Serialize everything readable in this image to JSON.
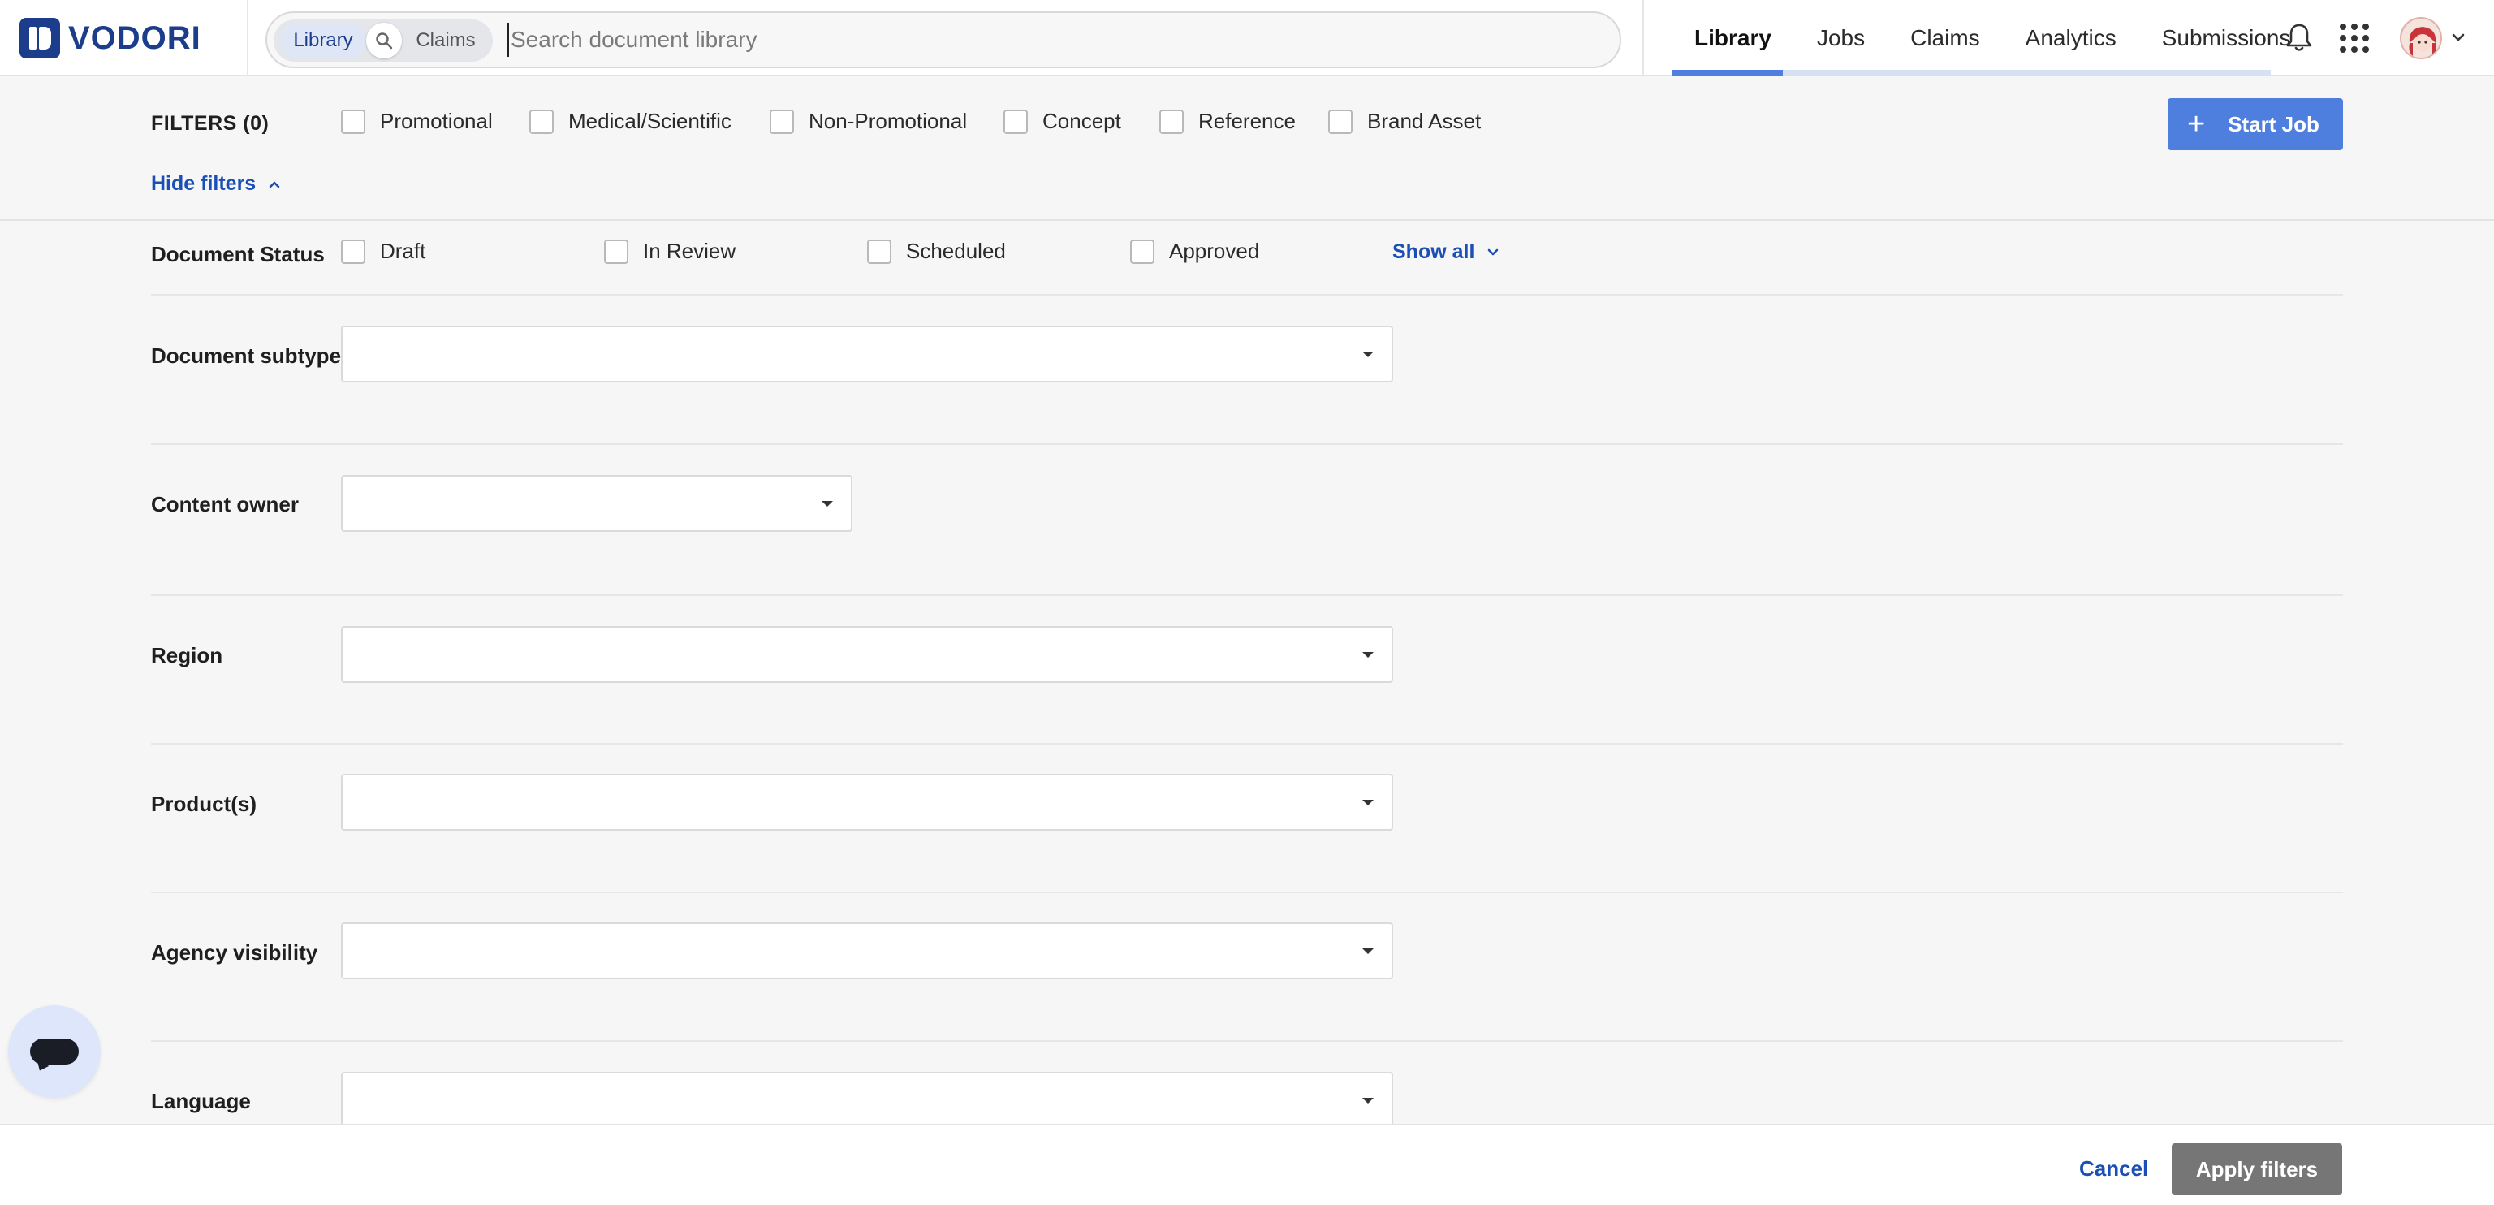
{
  "brand": {
    "name": "VODORI",
    "color": "#1c3c8c"
  },
  "search": {
    "scope_library": "Library",
    "scope_claims": "Claims",
    "placeholder": "Search document library"
  },
  "nav": {
    "items": [
      "Library",
      "Jobs",
      "Claims",
      "Analytics",
      "Submissions"
    ],
    "active": "Library",
    "accent": "#4f7fde"
  },
  "header_icons": {
    "notifications": "bell-icon",
    "apps": "grid-icon",
    "profile": "avatar",
    "profile_menu": "chevron-down-icon"
  },
  "filters": {
    "title": "FILTERS (0)",
    "content_types": [
      "Promotional",
      "Medical/Scientific",
      "Non-Promotional",
      "Concept",
      "Reference",
      "Brand Asset"
    ],
    "hide_label": "Hide filters",
    "start_job_label": "Start Job",
    "document_status": {
      "label": "Document Status",
      "options": [
        "Draft",
        "In Review",
        "Scheduled",
        "Approved"
      ],
      "show_all_label": "Show all"
    },
    "fields": [
      {
        "label": "Document subtype",
        "value": ""
      },
      {
        "label": "Content owner",
        "value": ""
      },
      {
        "label": "Region",
        "value": ""
      },
      {
        "label": "Product(s)",
        "value": ""
      },
      {
        "label": "Agency visibility",
        "value": ""
      },
      {
        "label": "Language",
        "value": ""
      }
    ]
  },
  "footer": {
    "cancel_label": "Cancel",
    "apply_label": "Apply filters"
  },
  "chat": {
    "icon": "chat-icon"
  }
}
